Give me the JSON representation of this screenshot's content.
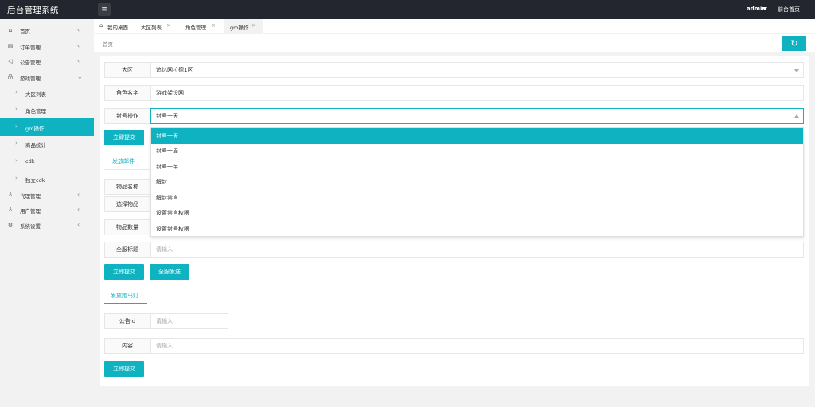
{
  "app": {
    "title": "后台管理系统"
  },
  "header": {
    "user": "admin",
    "front_link": "前台首页"
  },
  "sidebar": {
    "items": [
      {
        "label": "首页",
        "icon": "home-icon"
      },
      {
        "label": "订单管理",
        "icon": "order-icon"
      },
      {
        "label": "公告管理",
        "icon": "speaker-icon"
      },
      {
        "label": "游戏管理",
        "icon": "sitemap-icon"
      },
      {
        "label": "大区列表"
      },
      {
        "label": "角色管理"
      },
      {
        "label": "gm操作"
      },
      {
        "label": "商品统计"
      },
      {
        "label": "cdk"
      },
      {
        "label": "独立cdk"
      },
      {
        "label": "代理管理",
        "icon": "agent-icon"
      },
      {
        "label": "用户管理",
        "icon": "user-icon"
      },
      {
        "label": "系统设置",
        "icon": "gear-icon"
      }
    ]
  },
  "tabs": [
    {
      "label": "我的桌面"
    },
    {
      "label": "大区列表"
    },
    {
      "label": "角色管理"
    },
    {
      "label": "gm操作"
    }
  ],
  "breadcrumb": "首页",
  "form": {
    "region_label": "大区",
    "region_value": "追忆网拉德1区",
    "role_label": "角色名字",
    "role_value": "游戏架设网",
    "ban_label": "封号操作",
    "ban_value": "封号一天",
    "submit": "立即提交",
    "ban_options": [
      "封号一天",
      "封号一周",
      "封号一年",
      "解封",
      "解封禁言",
      "设置禁言权限",
      "设置封号权限"
    ]
  },
  "mail": {
    "tab": "发放邮件",
    "item_name_label": "物品名称",
    "select_item_label": "选择物品",
    "item_qty_label": "物品数量",
    "title_label": "全服标题",
    "title_placeholder": "请输入",
    "submit": "立即提交",
    "send_all": "全服发送"
  },
  "marquee": {
    "tab": "发放跑马灯",
    "notice_id_label": "公告id",
    "notice_id_placeholder": "请输入",
    "content_label": "内容",
    "content_placeholder": "请输入",
    "submit": "立即提交"
  },
  "colors": {
    "accent": "#0fb2c1",
    "header_bg": "#23262e"
  }
}
